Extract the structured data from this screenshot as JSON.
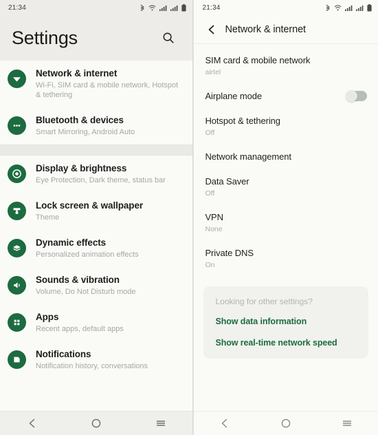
{
  "left": {
    "status": {
      "time": "21:34",
      "icons": [
        "bluetooth-icon",
        "wifi-icon",
        "signal-icon",
        "signal-icon",
        "battery-icon"
      ]
    },
    "header": {
      "title": "Settings",
      "search_icon": "search-icon"
    },
    "groups": [
      {
        "items": [
          {
            "icon": "wifi-icon",
            "title": "Network & internet",
            "subtitle": "Wi-Fi, SIM card & mobile network, Hotspot & tethering"
          },
          {
            "icon": "dots-icon",
            "title": "Bluetooth & devices",
            "subtitle": "Smart Mirroring, Android Auto"
          }
        ]
      },
      {
        "items": [
          {
            "icon": "brightness-icon",
            "title": "Display & brightness",
            "subtitle": "Eye Protection, Dark theme, status bar"
          },
          {
            "icon": "wallpaper-brush-icon",
            "title": "Lock screen & wallpaper",
            "subtitle": "Theme"
          },
          {
            "icon": "layers-icon",
            "title": "Dynamic effects",
            "subtitle": "Personalized animation effects"
          },
          {
            "icon": "speaker-icon",
            "title": "Sounds & vibration",
            "subtitle": "Volume, Do Not Disturb mode"
          },
          {
            "icon": "apps-grid-icon",
            "title": "Apps",
            "subtitle": "Recent apps, default apps"
          },
          {
            "icon": "bell-icon",
            "title": "Notifications",
            "subtitle": "Notification history, conversations"
          }
        ]
      }
    ],
    "navbar": {
      "back": "back-icon",
      "home": "home-icon",
      "recents": "recents-icon"
    }
  },
  "right": {
    "status": {
      "time": "21:34",
      "icons": [
        "bluetooth-icon",
        "wifi-icon",
        "signal-icon",
        "signal-icon",
        "battery-icon"
      ]
    },
    "header": {
      "back_icon": "back-chevron-icon",
      "title": "Network & internet"
    },
    "rows": [
      {
        "title": "SIM card & mobile network",
        "subtitle": "airtel",
        "toggle": null
      },
      {
        "title": "Airplane mode",
        "subtitle": null,
        "toggle": "off"
      },
      {
        "title": "Hotspot & tethering",
        "subtitle": "Off",
        "toggle": null
      },
      {
        "title": "Network management",
        "subtitle": null,
        "toggle": null
      },
      {
        "title": "Data Saver",
        "subtitle": "Off",
        "toggle": null
      },
      {
        "title": "VPN",
        "subtitle": "None",
        "toggle": null
      },
      {
        "title": "Private DNS",
        "subtitle": "On",
        "toggle": null
      }
    ],
    "other_card": {
      "title": "Looking for other settings?",
      "links": [
        "Show data information",
        "Show real-time network speed"
      ]
    },
    "navbar": {
      "back": "back-icon",
      "home": "home-icon",
      "recents": "recents-icon"
    }
  },
  "colors": {
    "accent_green": "#1d6b40",
    "header_bg": "#edece8",
    "list_bg": "#fafbf7",
    "toggle_off": "#b8bdb8"
  }
}
